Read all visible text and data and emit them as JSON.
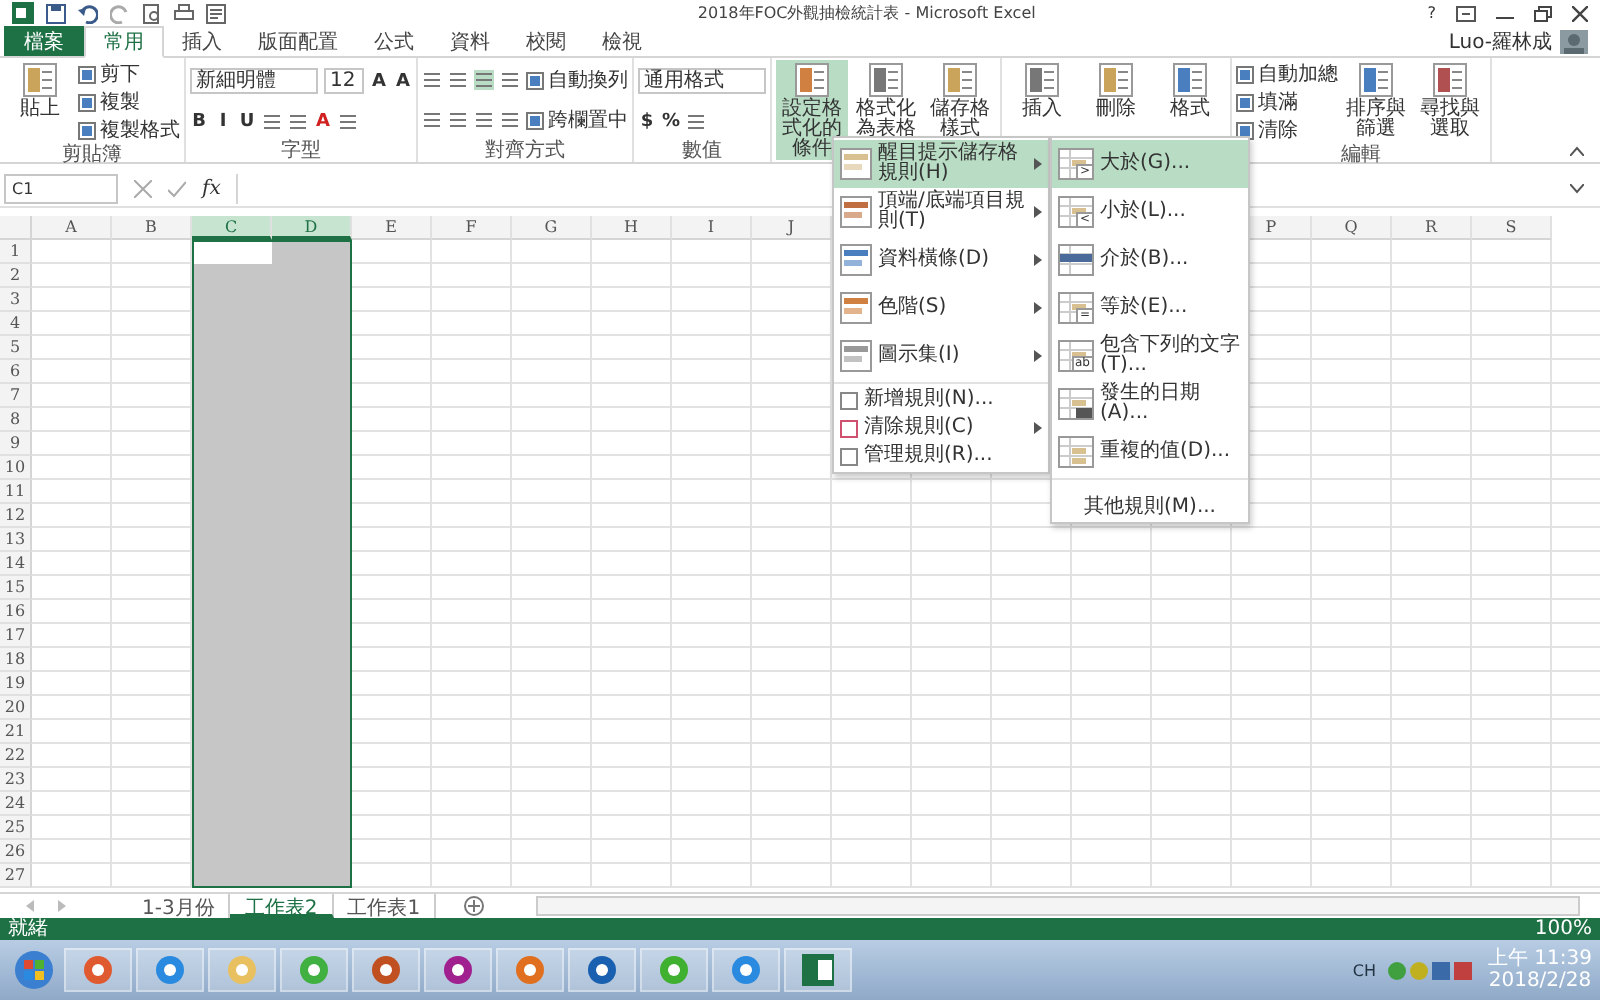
{
  "window": {
    "title": "2018年FOC外觀抽檢統計表 - Microsoft Excel",
    "help": "?",
    "user": "Luo-羅林成"
  },
  "tabs": [
    {
      "label": "檔案",
      "kind": "file",
      "selected": false
    },
    {
      "label": "常用",
      "kind": "tab",
      "selected": true
    },
    {
      "label": "插入",
      "kind": "tab",
      "selected": false
    },
    {
      "label": "版面配置",
      "kind": "tab",
      "selected": false
    },
    {
      "label": "公式",
      "kind": "tab",
      "selected": false
    },
    {
      "label": "資料",
      "kind": "tab",
      "selected": false
    },
    {
      "label": "校閱",
      "kind": "tab",
      "selected": false
    },
    {
      "label": "檢視",
      "kind": "tab",
      "selected": false
    }
  ],
  "ribbon": {
    "groups": [
      {
        "label": "剪貼簿",
        "items": [
          {
            "kind": "large",
            "label": "貼上",
            "selected": false
          },
          {
            "kind": "stack",
            "lines": [
              {
                "controls": [
                  {
                    "kind": "button",
                    "label": "剪下"
                  }
                ]
              },
              {
                "controls": [
                  {
                    "kind": "button",
                    "label": "複製"
                  }
                ]
              },
              {
                "controls": [
                  {
                    "kind": "button",
                    "label": "複製格式"
                  }
                ]
              }
            ]
          }
        ]
      },
      {
        "label": "字型",
        "items": [
          {
            "kind": "stack",
            "lines": [
              {
                "controls": [
                  {
                    "kind": "field",
                    "value": "新細明體"
                  },
                  {
                    "kind": "size-field",
                    "value": "12"
                  },
                  {
                    "kind": "glyph",
                    "label": "A"
                  },
                  {
                    "kind": "glyph",
                    "label": "A"
                  }
                ]
              },
              {
                "controls": [
                  {
                    "kind": "glyph",
                    "label": "B"
                  },
                  {
                    "kind": "glyph",
                    "label": "I"
                  },
                  {
                    "kind": "glyph",
                    "label": "U"
                  },
                  {
                    "kind": "icon"
                  },
                  {
                    "kind": "icon"
                  },
                  {
                    "kind": "color-glyph",
                    "label": "A"
                  },
                  {
                    "kind": "icon"
                  }
                ]
              }
            ]
          }
        ]
      },
      {
        "label": "對齊方式",
        "items": [
          {
            "kind": "stack",
            "lines": [
              {
                "controls": [
                  {
                    "kind": "icon"
                  },
                  {
                    "kind": "icon"
                  },
                  {
                    "kind": "icon-on"
                  },
                  {
                    "kind": "icon"
                  },
                  {
                    "kind": "button",
                    "label": "自動換列"
                  }
                ]
              },
              {
                "controls": [
                  {
                    "kind": "icon"
                  },
                  {
                    "kind": "icon"
                  },
                  {
                    "kind": "icon"
                  },
                  {
                    "kind": "icon"
                  },
                  {
                    "kind": "button",
                    "label": "跨欄置中"
                  }
                ]
              }
            ]
          }
        ]
      },
      {
        "label": "數值",
        "items": [
          {
            "kind": "stack",
            "lines": [
              {
                "controls": [
                  {
                    "kind": "field",
                    "value": "通用格式"
                  }
                ]
              },
              {
                "controls": [
                  {
                    "kind": "glyph",
                    "label": "$"
                  },
                  {
                    "kind": "glyph",
                    "label": "%"
                  },
                  {
                    "kind": "icon"
                  }
                ]
              }
            ]
          }
        ]
      },
      {
        "items": [
          {
            "kind": "large",
            "label": "設定格式化的條件",
            "selected": true
          },
          {
            "kind": "large",
            "label": "格式化為表格",
            "selected": false
          },
          {
            "kind": "large",
            "label": "儲存格樣式",
            "selected": false
          }
        ]
      },
      {
        "items": [
          {
            "kind": "large",
            "label": "插入",
            "selected": false
          },
          {
            "kind": "large",
            "label": "刪除",
            "selected": false
          },
          {
            "kind": "large",
            "label": "格式",
            "selected": false
          }
        ]
      },
      {
        "label": "編輯",
        "items": [
          {
            "kind": "stack",
            "lines": [
              {
                "controls": [
                  {
                    "kind": "button",
                    "label": "自動加總"
                  }
                ]
              },
              {
                "controls": [
                  {
                    "kind": "button",
                    "label": "填滿"
                  }
                ]
              },
              {
                "controls": [
                  {
                    "kind": "button",
                    "label": "清除"
                  }
                ]
              }
            ]
          },
          {
            "kind": "large",
            "label": "排序與篩選",
            "selected": false
          },
          {
            "kind": "large",
            "label": "尋找與選取",
            "selected": false
          }
        ]
      }
    ]
  },
  "formula_bar": {
    "name_box": "C1",
    "fx": "fx"
  },
  "columns": [
    {
      "label": "A",
      "selected": false
    },
    {
      "label": "B",
      "selected": false
    },
    {
      "label": "C",
      "selected": true
    },
    {
      "label": "D",
      "selected": true
    },
    {
      "label": "E",
      "selected": false
    },
    {
      "label": "F",
      "selected": false
    },
    {
      "label": "G",
      "selected": false
    },
    {
      "label": "H",
      "selected": false
    },
    {
      "label": "I",
      "selected": false
    },
    {
      "label": "J",
      "selected": false
    }
  ],
  "columns_right": [
    {
      "label": "P",
      "selected": false
    },
    {
      "label": "Q",
      "selected": false
    },
    {
      "label": "R",
      "selected": false
    },
    {
      "label": "S",
      "selected": false
    }
  ],
  "rows": [
    "1",
    "2",
    "3",
    "4",
    "5",
    "6",
    "7",
    "8",
    "9",
    "10",
    "11",
    "12",
    "13",
    "14",
    "15",
    "16",
    "17",
    "18",
    "19",
    "20",
    "21",
    "22",
    "23",
    "24",
    "25",
    "26",
    "27"
  ],
  "menu": {
    "items": [
      {
        "label": "醒目提示儲存格規則(H)",
        "kind": "large",
        "submenu": true,
        "selected": true
      },
      {
        "label": "頂端/底端項目規則(T)",
        "kind": "large",
        "submenu": true,
        "selected": false
      },
      {
        "label": "資料橫條(D)",
        "kind": "large",
        "submenu": true,
        "selected": false
      },
      {
        "label": "色階(S)",
        "kind": "large",
        "submenu": true,
        "selected": false
      },
      {
        "label": "圖示集(I)",
        "kind": "large",
        "submenu": true,
        "selected": false
      },
      {
        "label": "新增規則(N)...",
        "kind": "small",
        "submenu": false,
        "selected": false
      },
      {
        "label": "清除規則(C)",
        "kind": "small",
        "submenu": true,
        "selected": false
      },
      {
        "label": "管理規則(R)...",
        "kind": "small",
        "submenu": false,
        "selected": false
      }
    ],
    "submenu": {
      "items": [
        {
          "label": "大於(G)...",
          "sign": ">",
          "selected": true
        },
        {
          "label": "小於(L)...",
          "sign": "<",
          "selected": false
        },
        {
          "label": "介於(B)...",
          "kind": "between",
          "selected": false
        },
        {
          "label": "等於(E)...",
          "sign": "=",
          "selected": false
        },
        {
          "label": "包含下列的文字(T)...",
          "sign": "ab",
          "selected": false
        },
        {
          "label": "發生的日期(A)...",
          "kind": "date",
          "selected": false
        },
        {
          "label": "重複的值(D)...",
          "kind": "dup",
          "selected": false
        }
      ],
      "footer": "其他規則(M)..."
    }
  },
  "sheets": [
    {
      "label": "1-3月份",
      "selected": false
    },
    {
      "label": "工作表2",
      "selected": true
    },
    {
      "label": "工作表1",
      "selected": false
    }
  ],
  "status_bar": {
    "text": "就緒",
    "zoom": "100%"
  },
  "taskbar": {
    "apps": [
      {
        "kind": "start"
      },
      {
        "kind": "tiles"
      },
      {
        "kind": "ie"
      },
      {
        "kind": "folder"
      },
      {
        "kind": "leaf"
      },
      {
        "kind": "fox"
      },
      {
        "kind": "q"
      },
      {
        "kind": "media"
      },
      {
        "kind": "outlook"
      },
      {
        "kind": "wechat"
      },
      {
        "kind": "ie"
      },
      {
        "kind": "excel"
      }
    ],
    "tray": {
      "lang": "CH",
      "time": "上午 11:39",
      "date": "2018/2/28"
    }
  }
}
